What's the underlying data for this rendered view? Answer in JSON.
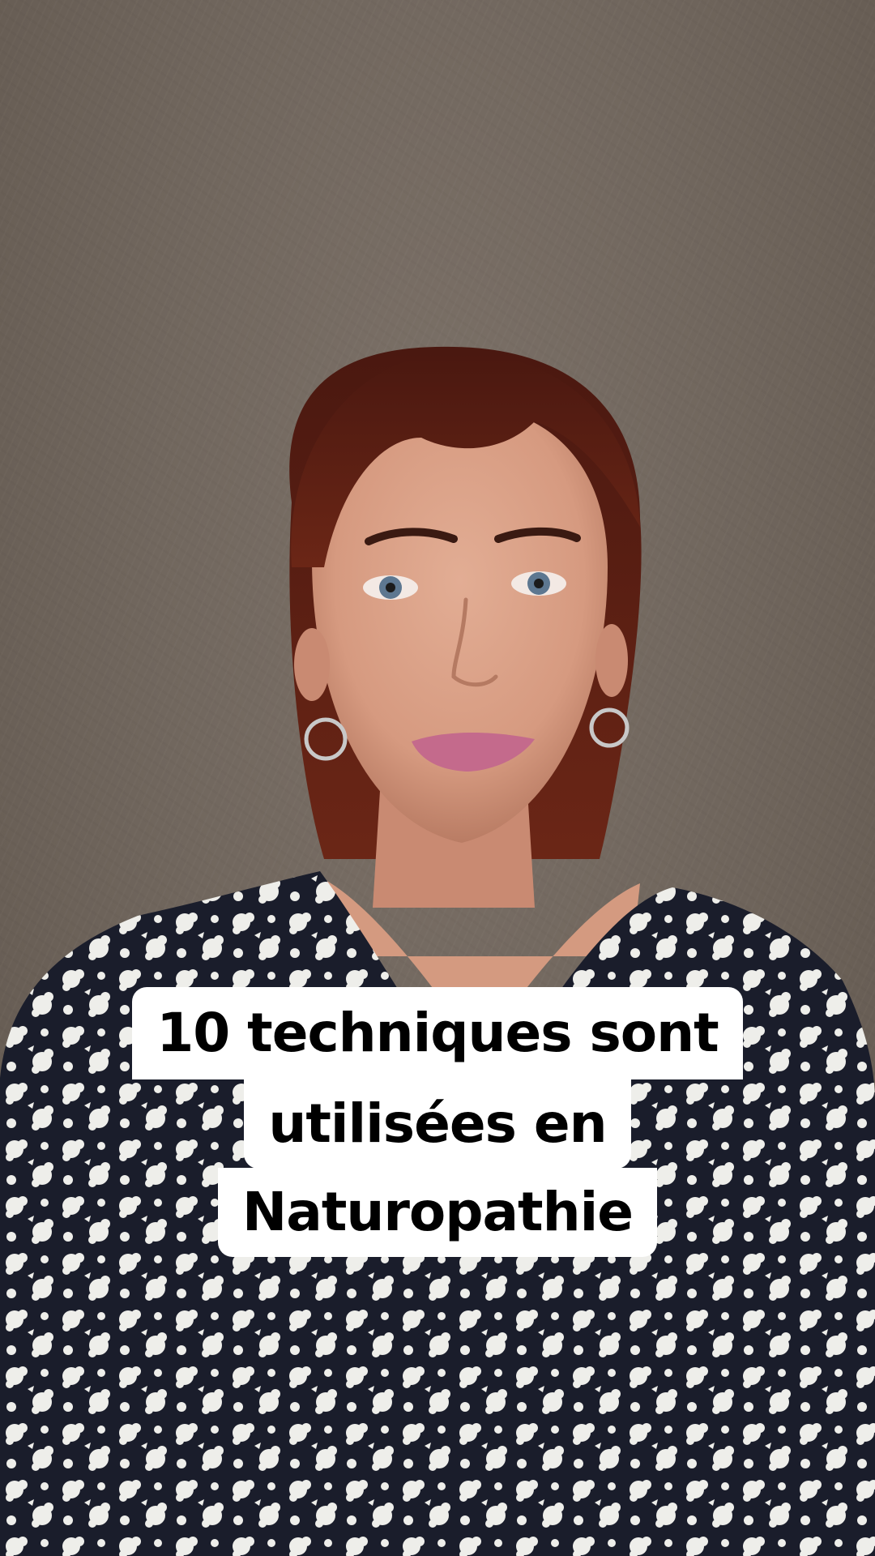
{
  "caption": {
    "line1": "10 techniques sont",
    "line2": "utilisées en",
    "line3": "Naturopathie"
  },
  "colors": {
    "background_wall": "#71675e",
    "caption_bg": "#ffffff",
    "caption_text": "#000000",
    "hair": "#5a1f17",
    "dress_dark": "#1a1d2b",
    "dress_light": "#eeeeea",
    "lips": "#c46a8c"
  },
  "scene": {
    "subject": "woman-portrait",
    "icons": [
      "hoop-earring-icon"
    ]
  }
}
